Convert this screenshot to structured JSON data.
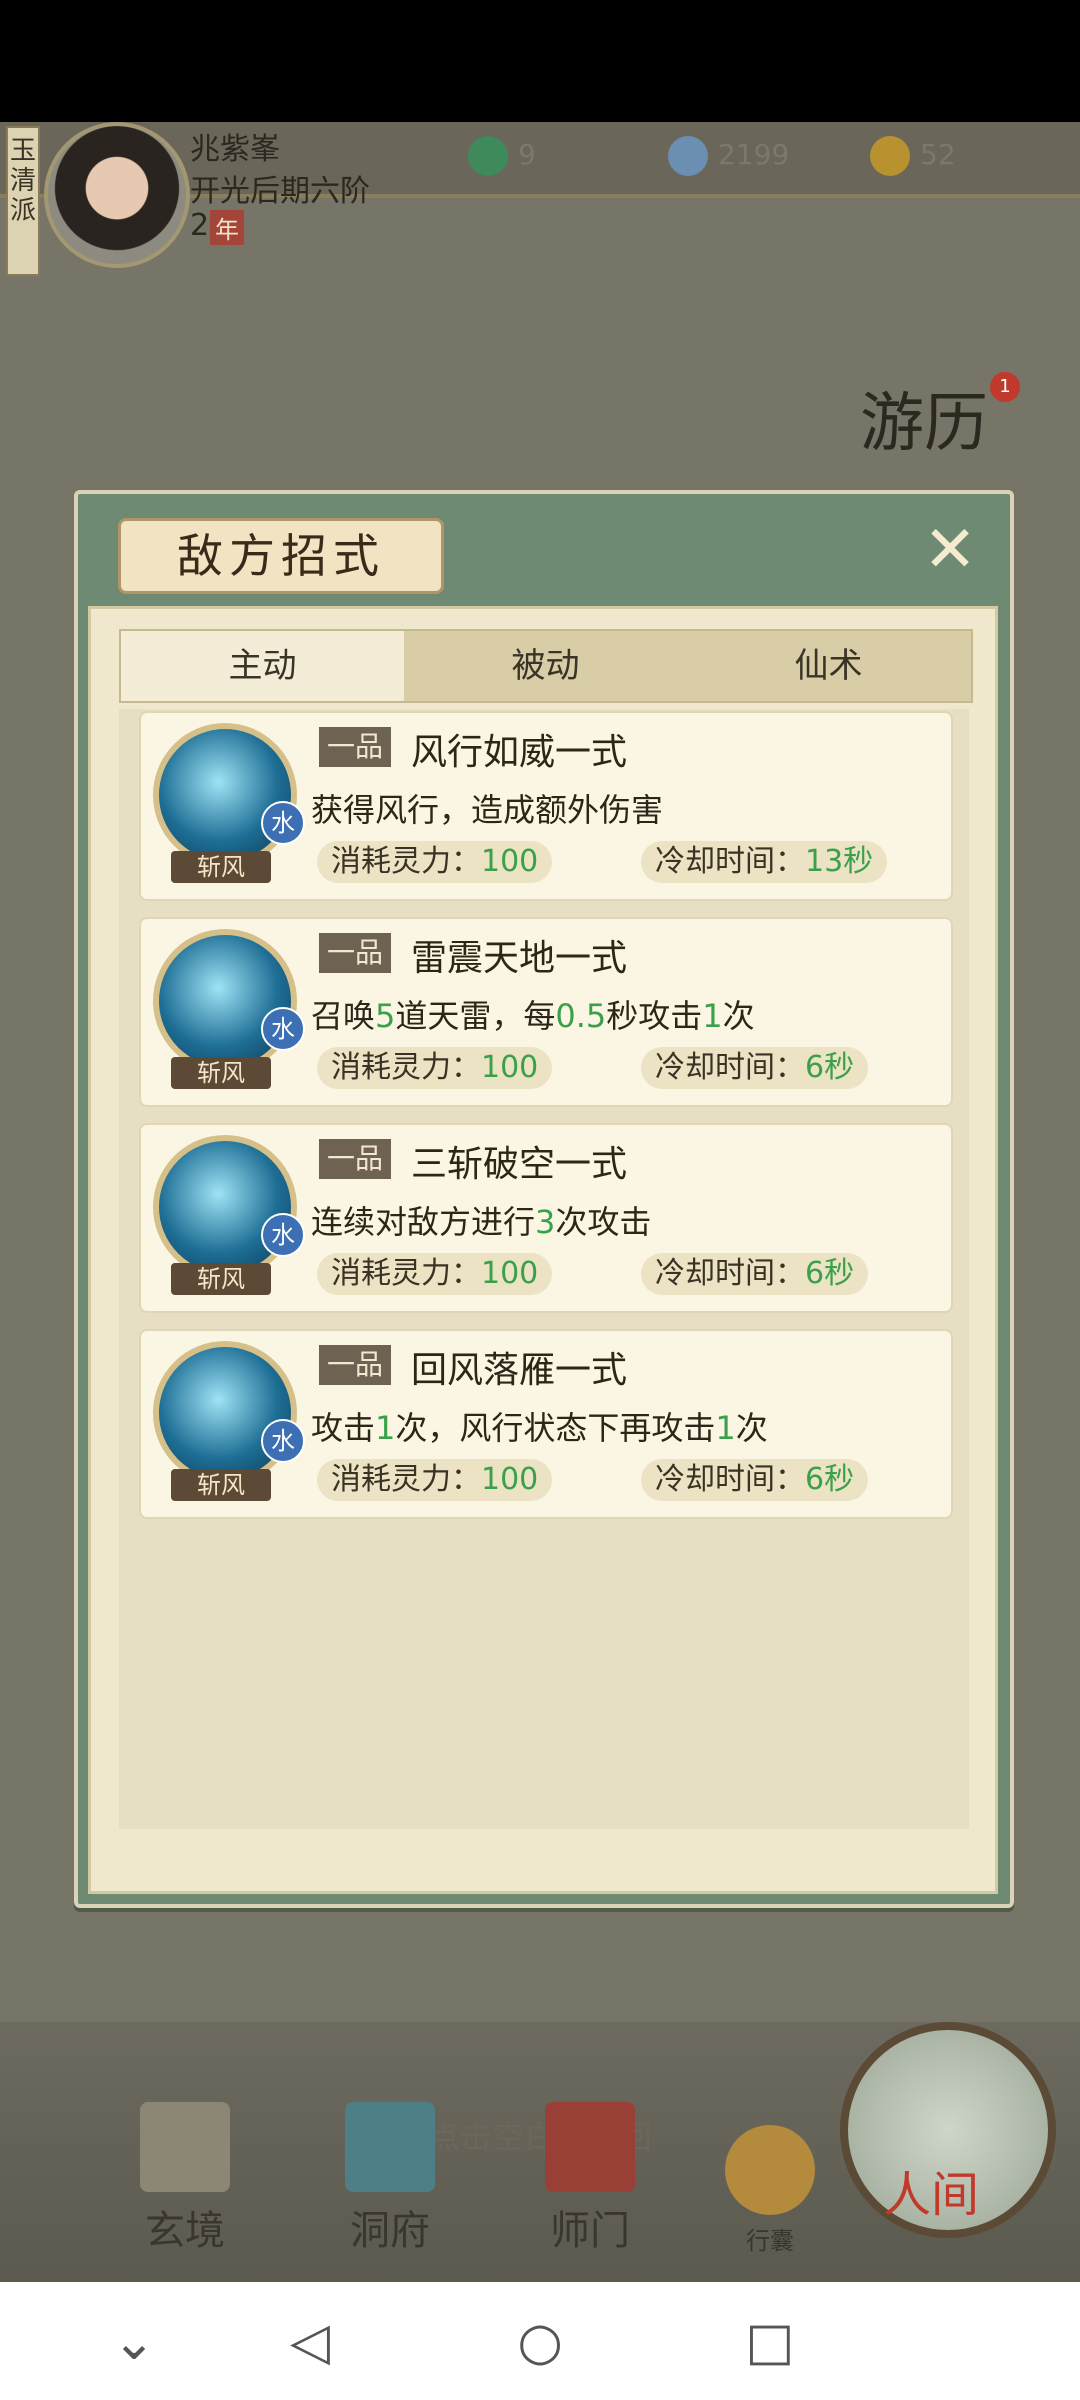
{
  "player": {
    "sect": "玉清派",
    "name": "兆紫峯",
    "rank": "开光后期六阶",
    "year_num": "2",
    "year_unit": "年"
  },
  "resources": [
    {
      "name": "spirit",
      "value": "9"
    },
    {
      "name": "coin",
      "value": "2199"
    },
    {
      "name": "ingot",
      "value": "52"
    }
  ],
  "adventure": {
    "label": "游历",
    "badge": "1"
  },
  "dialog": {
    "title": "敌方招式",
    "tabs": [
      "主动",
      "被动",
      "仙术"
    ],
    "active_tab": "主动"
  },
  "skills": [
    {
      "grade": "一品",
      "title": "风行如威一式",
      "element": "水",
      "tag": "斩风",
      "desc_parts": [
        "获得风行，造成额外伤害"
      ],
      "cost_label": "消耗灵力：",
      "cost": "100",
      "cd_label": "冷却时间：",
      "cd": "13秒"
    },
    {
      "grade": "一品",
      "title": "雷震天地一式",
      "element": "水",
      "tag": "斩风",
      "desc_parts": [
        "召唤",
        "5",
        "道天雷，每",
        "0.5",
        "秒攻击",
        "1",
        "次"
      ],
      "cost_label": "消耗灵力：",
      "cost": "100",
      "cd_label": "冷却时间：",
      "cd": "6秒"
    },
    {
      "grade": "一品",
      "title": "三斩破空一式",
      "element": "水",
      "tag": "斩风",
      "desc_parts": [
        "连续对敌方进行",
        "3",
        "次攻击"
      ],
      "cost_label": "消耗灵力：",
      "cost": "100",
      "cd_label": "冷却时间：",
      "cd": "6秒"
    },
    {
      "grade": "一品",
      "title": "回风落雁一式",
      "element": "水",
      "tag": "斩风",
      "desc_parts": [
        "攻击",
        "1",
        "次，风行状态下再攻击",
        "1",
        "次"
      ],
      "cost_label": "消耗灵力：",
      "cost": "100",
      "cd_label": "冷却时间：",
      "cd": "6秒"
    }
  ],
  "hint": "点击空白处返回",
  "bottom_nav": [
    "玄境",
    "洞府",
    "师门",
    "行囊",
    "人间"
  ],
  "colors": {
    "dialog_frame": "#6e8a72",
    "highlight": "#3aa04a",
    "parchment": "#fbf6e4"
  }
}
